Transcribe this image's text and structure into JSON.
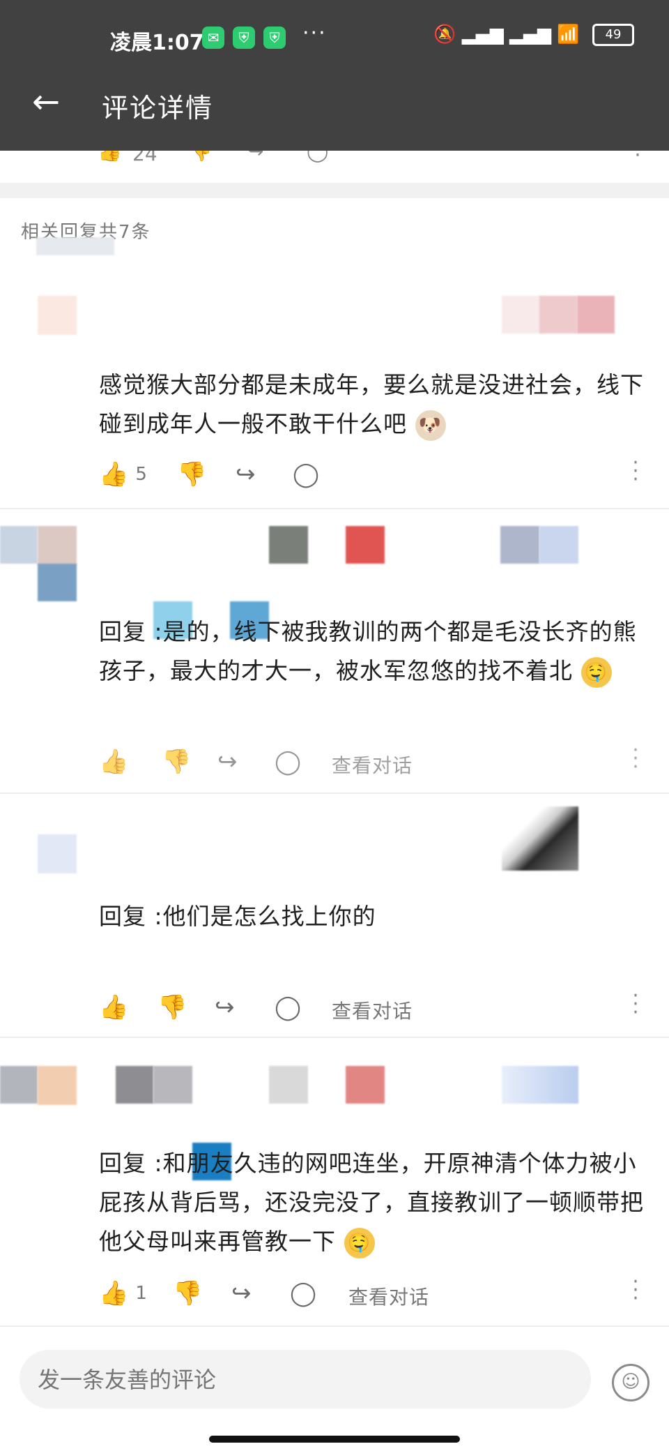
{
  "status_bar": {
    "time": "凌晨1:07",
    "dots": "···",
    "battery": "49"
  },
  "header": {
    "title": "评论详情"
  },
  "top_post_actions": {
    "like_count": "24"
  },
  "replies_header": "相关回复共7条",
  "comments": [
    {
      "text": "感觉猴大部分都是未成年，要么就是没进社会，线下碰到成年人一般不敢干什么吧",
      "like_count": "5"
    },
    {
      "text": "回复            :是的，线下被我教训的两个都是毛没长齐的熊孩子，最大的才大一，被水军忽悠的找不着北",
      "view_conversation": "查看对话"
    },
    {
      "text": "回复                              :他们是怎么找上你的",
      "view_conversation": "查看对话"
    },
    {
      "text": "回复             :和朋友久违的网吧连坐，开原神清个体力被小屁孩从背后骂，还没完没了，直接教训了一顿顺带把他父母叫来再管教一下",
      "like_count": "1",
      "view_conversation": "查看对话"
    }
  ],
  "input": {
    "placeholder": "发一条友善的评论"
  },
  "colors": {
    "header_bg": "#414141",
    "accent": "#2ecc71"
  }
}
